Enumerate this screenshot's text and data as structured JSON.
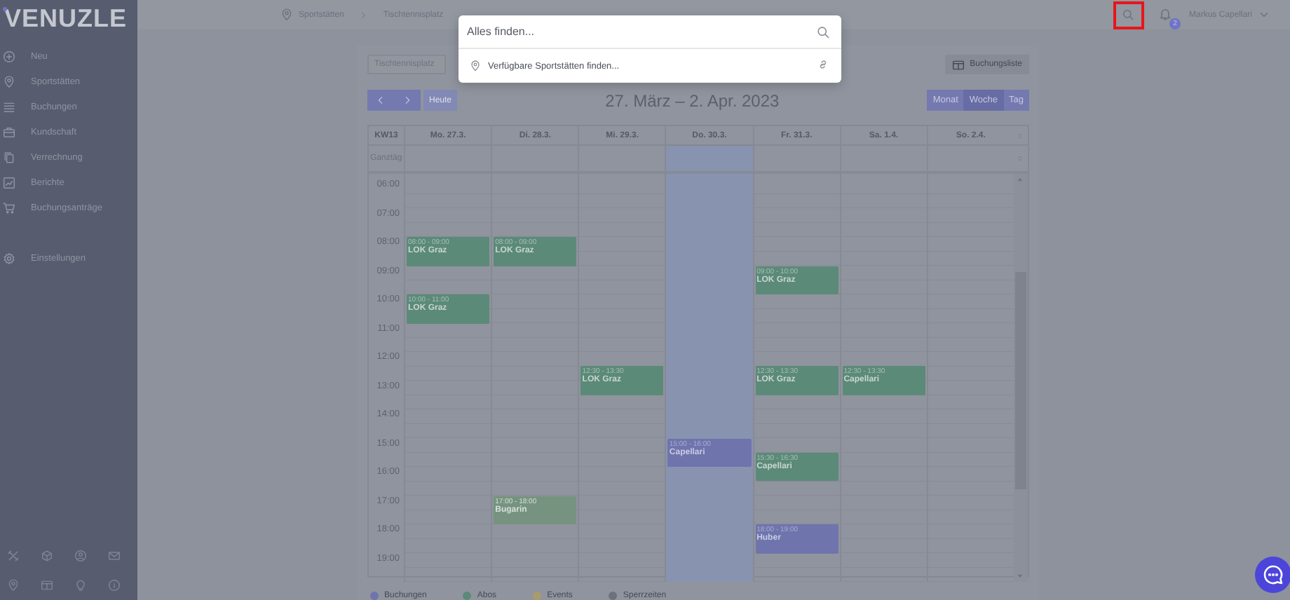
{
  "sidebar": {
    "logo": "VENUZLE",
    "items": [
      {
        "label": "Neu"
      },
      {
        "label": "Sportstätten"
      },
      {
        "label": "Buchungen"
      },
      {
        "label": "Kundschaft"
      },
      {
        "label": "Verrechnung"
      },
      {
        "label": "Berichte"
      },
      {
        "label": "Buchungsanträge"
      },
      {
        "label": "Einstellungen"
      }
    ]
  },
  "topbar": {
    "breadcrumbs": [
      "Sportstätten",
      "Tischtennisplatz"
    ],
    "notifications": "2",
    "user": "Markus Capellari"
  },
  "search_popup": {
    "placeholder": "Alles finden...",
    "suggestion": "Verfügbare Sportstätten finden..."
  },
  "calendar": {
    "resource": "Tischtennisplatz",
    "list_button": "Buchungsliste",
    "today_button": "Heute",
    "title": "27. März – 2. Apr. 2023",
    "views": [
      {
        "label": "Monat",
        "selected": false
      },
      {
        "label": "Woche",
        "selected": true
      },
      {
        "label": "Tag",
        "selected": false
      }
    ],
    "week": "KW13",
    "allday": "Ganztäg",
    "hours": [
      "06:00",
      "07:00",
      "08:00",
      "09:00",
      "10:00",
      "11:00",
      "12:00",
      "13:00",
      "14:00",
      "15:00",
      "16:00",
      "17:00",
      "18:00",
      "19:00"
    ],
    "days": [
      {
        "label": "Mo. 27.3.",
        "today": false,
        "events": [
          {
            "time": "08:00 - 09:00",
            "title": "LOK Graz",
            "kind": "abo",
            "faded": false
          },
          {
            "time": "10:00 - 11:00",
            "title": "LOK Graz",
            "kind": "abo",
            "faded": false
          }
        ]
      },
      {
        "label": "Di. 28.3.",
        "today": false,
        "events": [
          {
            "time": "08:00 - 09:00",
            "title": "LOK Graz",
            "kind": "abo",
            "faded": false
          },
          {
            "time": "17:00 - 18:00",
            "title": "Bugarin",
            "kind": "abo",
            "faded": true
          }
        ]
      },
      {
        "label": "Mi. 29.3.",
        "today": false,
        "events": [
          {
            "time": "12:30 - 13:30",
            "title": "LOK Graz",
            "kind": "abo",
            "faded": false
          }
        ]
      },
      {
        "label": "Do. 30.3.",
        "today": true,
        "events": [
          {
            "time": "15:00 - 16:00",
            "title": "Capellari",
            "kind": "buchung",
            "faded": false
          }
        ]
      },
      {
        "label": "Fr. 31.3.",
        "today": false,
        "events": [
          {
            "time": "09:00 - 10:00",
            "title": "LOK Graz",
            "kind": "abo",
            "faded": false
          },
          {
            "time": "12:30 - 13:30",
            "title": "LOK Graz",
            "kind": "abo",
            "faded": false
          },
          {
            "time": "15:30 - 16:30",
            "title": "Capellari",
            "kind": "abo",
            "faded": false
          },
          {
            "time": "18:00 - 19:00",
            "title": "Huber",
            "kind": "buchung",
            "faded": false
          }
        ]
      },
      {
        "label": "Sa. 1.4.",
        "today": false,
        "events": [
          {
            "time": "12:30 - 13:30",
            "title": "Capellari",
            "kind": "abo",
            "faded": false
          }
        ]
      },
      {
        "label": "So. 2.4.",
        "today": false
      }
    ],
    "legend": [
      {
        "label": "Buchungen",
        "color": "#6f74ad"
      },
      {
        "label": "Abos",
        "color": "#5b8a78"
      },
      {
        "label": "Events",
        "color": "#a89c6c"
      },
      {
        "label": "Sperrzeiten",
        "color": "#6c717c"
      }
    ]
  }
}
